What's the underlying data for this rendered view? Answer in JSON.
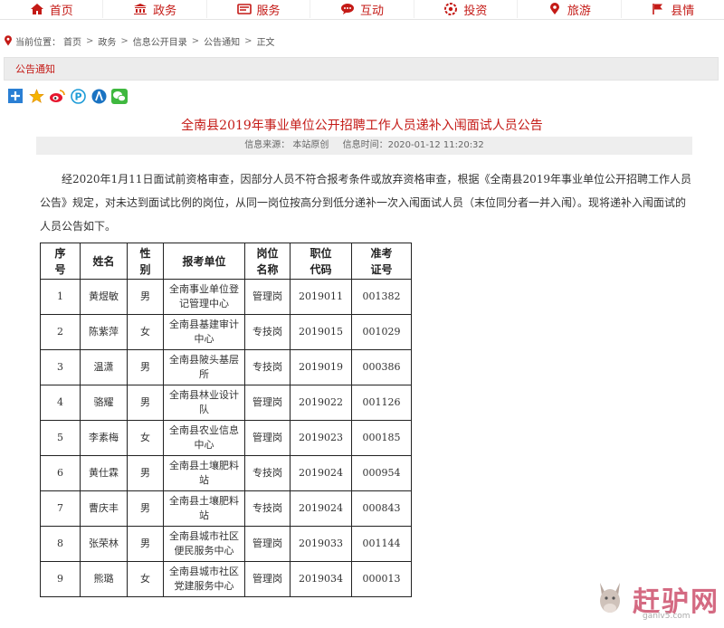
{
  "nav": {
    "items": [
      {
        "label": "首页",
        "icon": "home-icon"
      },
      {
        "label": "政务",
        "icon": "government-icon"
      },
      {
        "label": "服务",
        "icon": "service-icon"
      },
      {
        "label": "互动",
        "icon": "chat-icon"
      },
      {
        "label": "投资",
        "icon": "invest-icon"
      },
      {
        "label": "旅游",
        "icon": "location-pin-icon"
      },
      {
        "label": "县情",
        "icon": "flag-icon"
      }
    ]
  },
  "breadcrumb": {
    "prefix": "当前位置：",
    "items": [
      "首页",
      "政务",
      "信息公开目录",
      "公告通知",
      "正文"
    ]
  },
  "section": {
    "title": "公告通知"
  },
  "article": {
    "title": "全南县2019年事业单位公开招聘工作人员递补入闱面试人员公告",
    "source": "信息来源： 本站原创",
    "time": "信息时间：2020-01-12 11:20:32",
    "paragraph": "经2020年1月11日面试前资格审查，因部分人员不符合报考条件或放弃资格审查，根据《全南县2019年事业单位公开招聘工作人员公告》规定，对未达到面试比例的岗位，从同一岗位按高分到低分递补一次入闱面试人员（末位同分者一并入闱）。现将递补入闱面试的人员公告如下。"
  },
  "table": {
    "headers": [
      "序号",
      "姓名",
      "性别",
      "报考单位",
      "岗位名称",
      "职位代码",
      "准考证号"
    ],
    "rows": [
      [
        "1",
        "黄煜敏",
        "男",
        "全南事业单位登记管理中心",
        "管理岗",
        "2019011",
        "001382"
      ],
      [
        "2",
        "陈紫萍",
        "女",
        "全南县基建审计中心",
        "专技岗",
        "2019015",
        "001029"
      ],
      [
        "3",
        "温潇",
        "男",
        "全南县陂头基层所",
        "专技岗",
        "2019019",
        "000386"
      ],
      [
        "4",
        "骆耀",
        "男",
        "全南县林业设计队",
        "管理岗",
        "2019022",
        "001126"
      ],
      [
        "5",
        "李素梅",
        "女",
        "全南县农业信息中心",
        "管理岗",
        "2019023",
        "000185"
      ],
      [
        "6",
        "黄仕霖",
        "男",
        "全南县土壤肥料站",
        "专技岗",
        "2019024",
        "000954"
      ],
      [
        "7",
        "曹庆丰",
        "男",
        "全南县土壤肥料站",
        "专技岗",
        "2019024",
        "000843"
      ],
      [
        "8",
        "张荣林",
        "男",
        "全南县城市社区便民服务中心",
        "管理岗",
        "2019033",
        "001144"
      ],
      [
        "9",
        "熊璐",
        "女",
        "全南县城市社区党建服务中心",
        "管理岗",
        "2019034",
        "000013"
      ]
    ]
  },
  "watermark": {
    "text": "赶驴网",
    "url": "ganlv5.com"
  }
}
